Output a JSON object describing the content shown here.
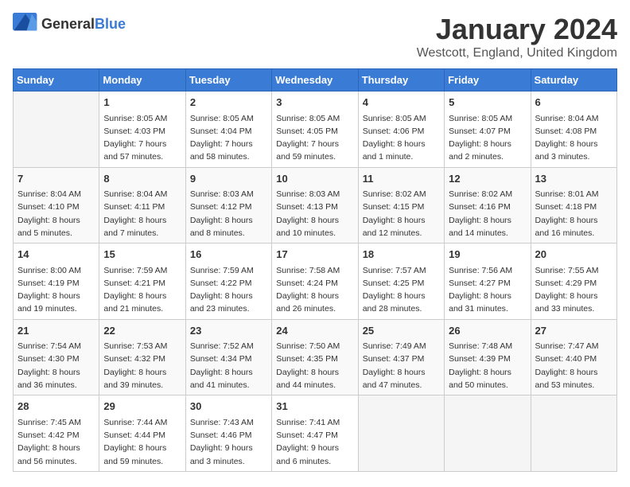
{
  "logo": {
    "general": "General",
    "blue": "Blue"
  },
  "title": "January 2024",
  "location": "Westcott, England, United Kingdom",
  "days_header": [
    "Sunday",
    "Monday",
    "Tuesday",
    "Wednesday",
    "Thursday",
    "Friday",
    "Saturday"
  ],
  "weeks": [
    [
      {
        "day": "",
        "info": ""
      },
      {
        "day": "1",
        "info": "Sunrise: 8:05 AM\nSunset: 4:03 PM\nDaylight: 7 hours\nand 57 minutes."
      },
      {
        "day": "2",
        "info": "Sunrise: 8:05 AM\nSunset: 4:04 PM\nDaylight: 7 hours\nand 58 minutes."
      },
      {
        "day": "3",
        "info": "Sunrise: 8:05 AM\nSunset: 4:05 PM\nDaylight: 7 hours\nand 59 minutes."
      },
      {
        "day": "4",
        "info": "Sunrise: 8:05 AM\nSunset: 4:06 PM\nDaylight: 8 hours\nand 1 minute."
      },
      {
        "day": "5",
        "info": "Sunrise: 8:05 AM\nSunset: 4:07 PM\nDaylight: 8 hours\nand 2 minutes."
      },
      {
        "day": "6",
        "info": "Sunrise: 8:04 AM\nSunset: 4:08 PM\nDaylight: 8 hours\nand 3 minutes."
      }
    ],
    [
      {
        "day": "7",
        "info": "Sunrise: 8:04 AM\nSunset: 4:10 PM\nDaylight: 8 hours\nand 5 minutes."
      },
      {
        "day": "8",
        "info": "Sunrise: 8:04 AM\nSunset: 4:11 PM\nDaylight: 8 hours\nand 7 minutes."
      },
      {
        "day": "9",
        "info": "Sunrise: 8:03 AM\nSunset: 4:12 PM\nDaylight: 8 hours\nand 8 minutes."
      },
      {
        "day": "10",
        "info": "Sunrise: 8:03 AM\nSunset: 4:13 PM\nDaylight: 8 hours\nand 10 minutes."
      },
      {
        "day": "11",
        "info": "Sunrise: 8:02 AM\nSunset: 4:15 PM\nDaylight: 8 hours\nand 12 minutes."
      },
      {
        "day": "12",
        "info": "Sunrise: 8:02 AM\nSunset: 4:16 PM\nDaylight: 8 hours\nand 14 minutes."
      },
      {
        "day": "13",
        "info": "Sunrise: 8:01 AM\nSunset: 4:18 PM\nDaylight: 8 hours\nand 16 minutes."
      }
    ],
    [
      {
        "day": "14",
        "info": "Sunrise: 8:00 AM\nSunset: 4:19 PM\nDaylight: 8 hours\nand 19 minutes."
      },
      {
        "day": "15",
        "info": "Sunrise: 7:59 AM\nSunset: 4:21 PM\nDaylight: 8 hours\nand 21 minutes."
      },
      {
        "day": "16",
        "info": "Sunrise: 7:59 AM\nSunset: 4:22 PM\nDaylight: 8 hours\nand 23 minutes."
      },
      {
        "day": "17",
        "info": "Sunrise: 7:58 AM\nSunset: 4:24 PM\nDaylight: 8 hours\nand 26 minutes."
      },
      {
        "day": "18",
        "info": "Sunrise: 7:57 AM\nSunset: 4:25 PM\nDaylight: 8 hours\nand 28 minutes."
      },
      {
        "day": "19",
        "info": "Sunrise: 7:56 AM\nSunset: 4:27 PM\nDaylight: 8 hours\nand 31 minutes."
      },
      {
        "day": "20",
        "info": "Sunrise: 7:55 AM\nSunset: 4:29 PM\nDaylight: 8 hours\nand 33 minutes."
      }
    ],
    [
      {
        "day": "21",
        "info": "Sunrise: 7:54 AM\nSunset: 4:30 PM\nDaylight: 8 hours\nand 36 minutes."
      },
      {
        "day": "22",
        "info": "Sunrise: 7:53 AM\nSunset: 4:32 PM\nDaylight: 8 hours\nand 39 minutes."
      },
      {
        "day": "23",
        "info": "Sunrise: 7:52 AM\nSunset: 4:34 PM\nDaylight: 8 hours\nand 41 minutes."
      },
      {
        "day": "24",
        "info": "Sunrise: 7:50 AM\nSunset: 4:35 PM\nDaylight: 8 hours\nand 44 minutes."
      },
      {
        "day": "25",
        "info": "Sunrise: 7:49 AM\nSunset: 4:37 PM\nDaylight: 8 hours\nand 47 minutes."
      },
      {
        "day": "26",
        "info": "Sunrise: 7:48 AM\nSunset: 4:39 PM\nDaylight: 8 hours\nand 50 minutes."
      },
      {
        "day": "27",
        "info": "Sunrise: 7:47 AM\nSunset: 4:40 PM\nDaylight: 8 hours\nand 53 minutes."
      }
    ],
    [
      {
        "day": "28",
        "info": "Sunrise: 7:45 AM\nSunset: 4:42 PM\nDaylight: 8 hours\nand 56 minutes."
      },
      {
        "day": "29",
        "info": "Sunrise: 7:44 AM\nSunset: 4:44 PM\nDaylight: 8 hours\nand 59 minutes."
      },
      {
        "day": "30",
        "info": "Sunrise: 7:43 AM\nSunset: 4:46 PM\nDaylight: 9 hours\nand 3 minutes."
      },
      {
        "day": "31",
        "info": "Sunrise: 7:41 AM\nSunset: 4:47 PM\nDaylight: 9 hours\nand 6 minutes."
      },
      {
        "day": "",
        "info": ""
      },
      {
        "day": "",
        "info": ""
      },
      {
        "day": "",
        "info": ""
      }
    ]
  ]
}
